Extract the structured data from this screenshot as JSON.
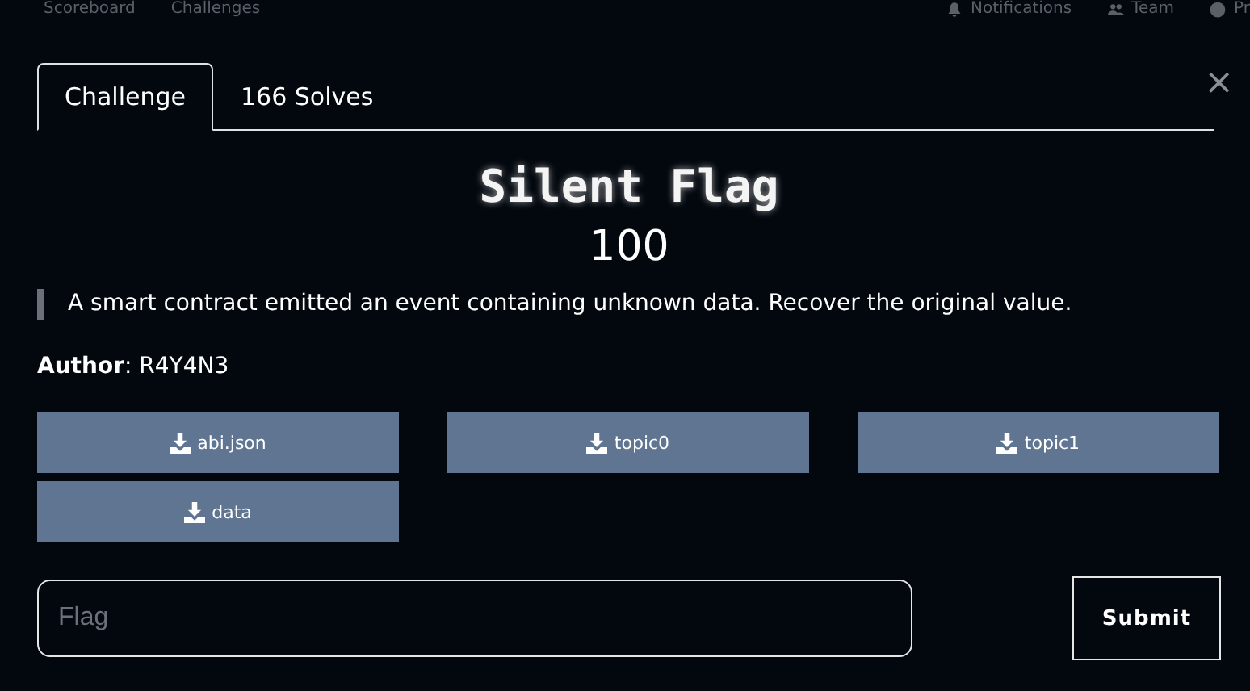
{
  "nav": {
    "left": [
      "Scoreboard",
      "Challenges"
    ],
    "right": [
      "Notifications",
      "Team",
      "Pr"
    ]
  },
  "tabs": [
    {
      "label": "Challenge",
      "selected": true
    },
    {
      "label": "166 Solves",
      "selected": false
    }
  ],
  "close": "×",
  "challenge": {
    "title": "Silent Flag",
    "points": "100",
    "description": "A smart contract emitted an event containing unknown data. Recover the original value.",
    "author": "**Author**: R4Y4N3"
  },
  "files": [
    "abi.json",
    "topic0",
    "topic1",
    "data"
  ],
  "flag": {
    "placeholder": "Flag"
  },
  "submit": "Submit"
}
